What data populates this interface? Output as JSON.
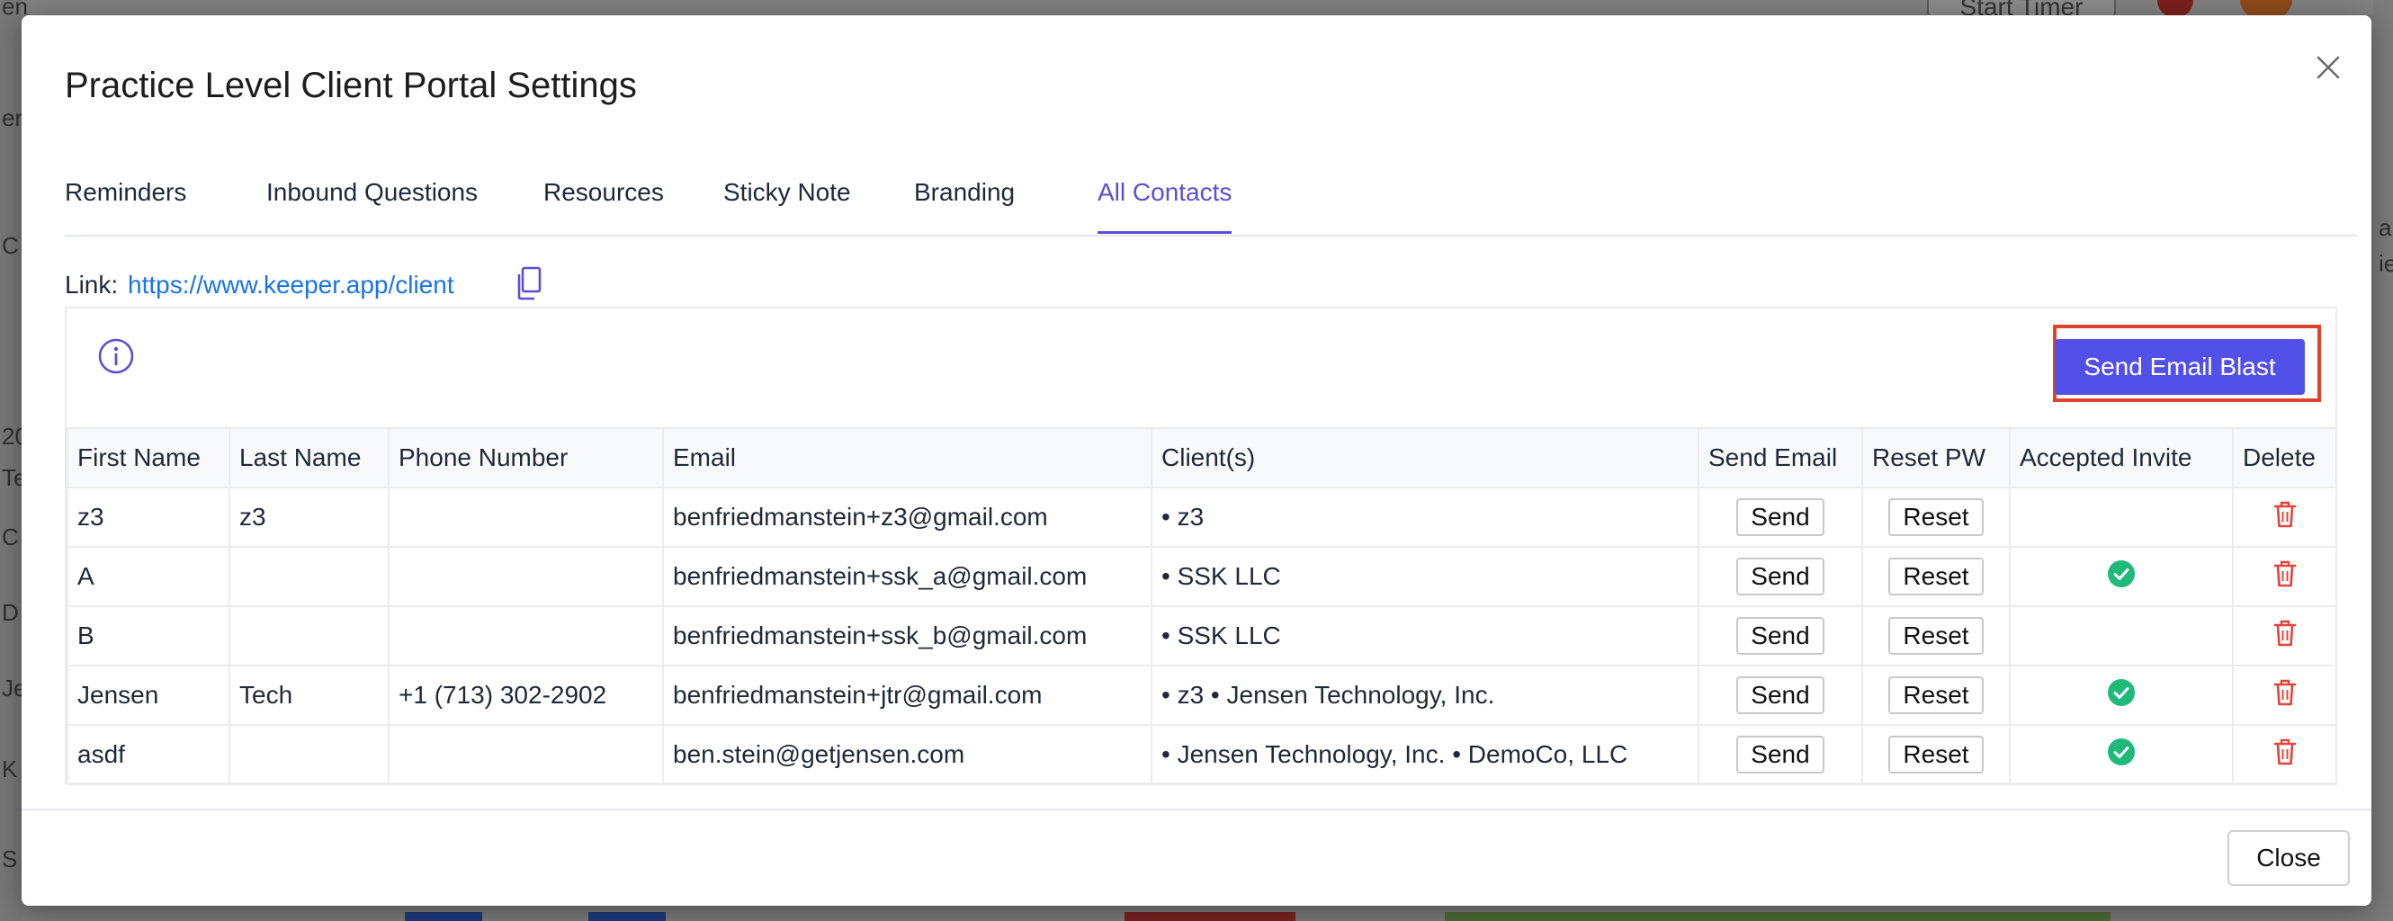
{
  "background": {
    "left_chars": [
      "en",
      "er",
      "C",
      "20",
      "Te",
      "C",
      "D",
      "Je",
      "K",
      "S"
    ],
    "right_chars": [
      "al",
      "ie"
    ],
    "timer_label": "Start Timer"
  },
  "modal": {
    "title": "Practice Level Client Portal Settings",
    "tabs": [
      {
        "label": "Reminders",
        "active": false
      },
      {
        "label": "Inbound Questions",
        "active": false
      },
      {
        "label": "Resources",
        "active": false
      },
      {
        "label": "Sticky Note",
        "active": false
      },
      {
        "label": "Branding",
        "active": false
      },
      {
        "label": "All Contacts",
        "active": true
      }
    ],
    "link_label": "Link:",
    "link_url": "https://www.keeper.app/client",
    "send_email_blast_label": "Send Email Blast",
    "close_label": "Close"
  },
  "table": {
    "headers": [
      "First Name",
      "Last Name",
      "Phone Number",
      "Email",
      "Client(s)",
      "Send Email",
      "Reset PW",
      "Accepted Invite",
      "Delete"
    ],
    "send_label": "Send",
    "reset_label": "Reset",
    "rows": [
      {
        "first": "z3",
        "last": "z3",
        "phone": "",
        "email": "benfriedmanstein+z3@gmail.com",
        "clients": "• z3",
        "accepted": false
      },
      {
        "first": "A",
        "last": "",
        "phone": "",
        "email": "benfriedmanstein+ssk_a@gmail.com",
        "clients": "• SSK LLC",
        "accepted": true
      },
      {
        "first": "B",
        "last": "",
        "phone": "",
        "email": "benfriedmanstein+ssk_b@gmail.com",
        "clients": "• SSK LLC",
        "accepted": false
      },
      {
        "first": "Jensen",
        "last": "Tech",
        "phone": "+1 (713) 302-2902",
        "email": "benfriedmanstein+jtr@gmail.com",
        "clients": "• z3 • Jensen Technology, Inc.",
        "accepted": true
      },
      {
        "first": "asdf",
        "last": "",
        "phone": "",
        "email": "ben.stein@getjensen.com",
        "clients": "• Jensen Technology, Inc. • DemoCo, LLC",
        "accepted": true
      }
    ]
  },
  "colors": {
    "accent": "#5a4fd6",
    "primary_button": "#5250e8",
    "link": "#1a73e8",
    "highlight_border": "#e0422b",
    "success": "#1fb97a",
    "danger": "#e0443a"
  }
}
